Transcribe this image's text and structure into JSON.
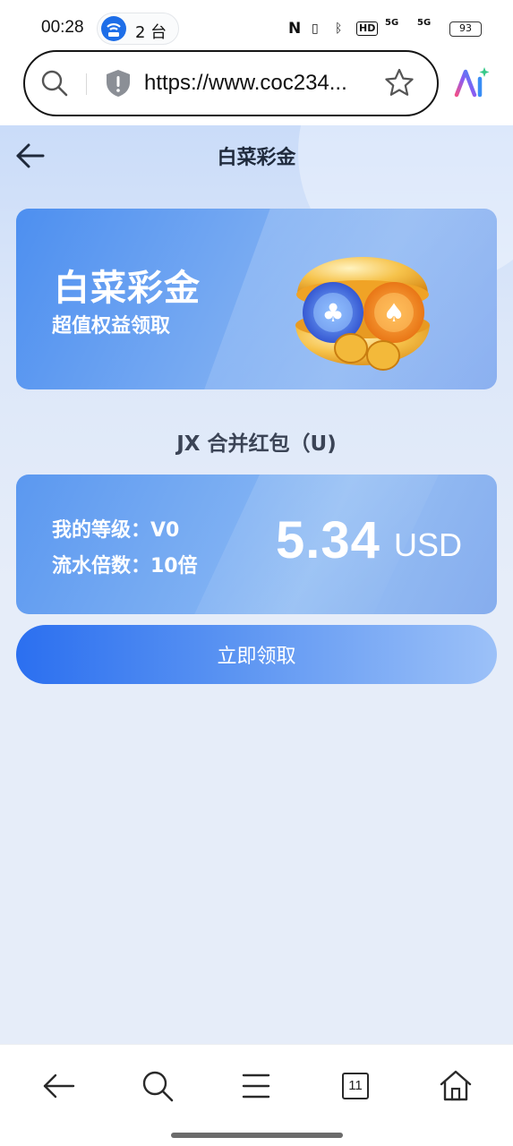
{
  "status_bar": {
    "time": "00:28",
    "hotspot_count": "2 台",
    "signal_1": "5G",
    "signal_2": "5G",
    "battery": "93",
    "hd_label": "HD"
  },
  "browser": {
    "url": "https://www.coc234...",
    "tab_count": "11"
  },
  "page": {
    "title": "白菜彩金",
    "hero": {
      "title": "白菜彩金",
      "subtitle": "超值权益领取"
    },
    "section_title": "JX 合并红包（U)",
    "reward": {
      "level_label": "我的等级：V0",
      "turnover_label": "流水倍数：10倍",
      "amount": "5.34",
      "unit": "USD"
    },
    "claim_button": "立即领取"
  },
  "colors": {
    "accent": "#2b6ff0",
    "card_gradient_start": "#5b98f0",
    "page_bg": "#e6edf9"
  },
  "icons": {
    "back": "arrow-left-icon",
    "search": "search-icon",
    "shield": "shield-icon",
    "star": "star-icon",
    "ai": "ai-assistant-icon",
    "menu": "menu-icon",
    "home": "home-icon",
    "tabs": "tabs-icon"
  }
}
